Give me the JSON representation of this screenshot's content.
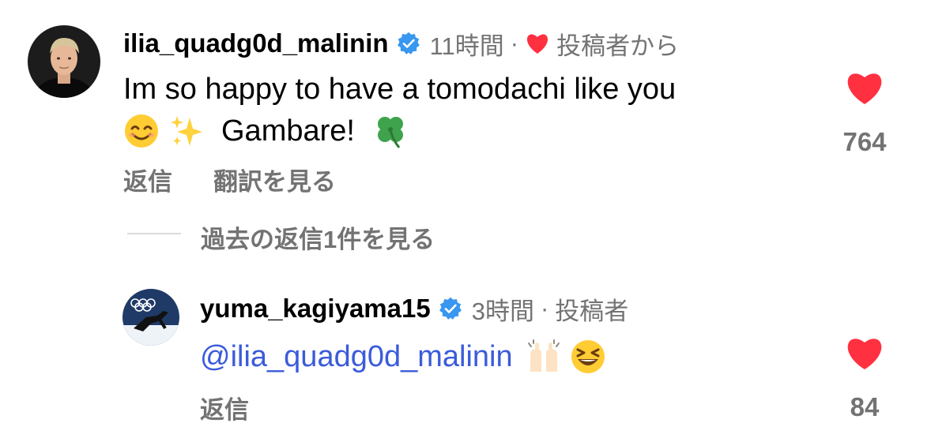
{
  "comment": {
    "username": "ilia_quadg0d_malinin",
    "time": "11時間",
    "dot": "·",
    "liked_by": "投稿者から",
    "text_line1": "Im so happy to have a tomodachi like you",
    "text_line2": "Gambare!",
    "emojis": [
      "smiling-face-emoji",
      "sparkles-emoji",
      "four-leaf-clover-emoji"
    ],
    "like_count": "764",
    "reply_label": "返信",
    "translate_label": "翻訳を見る",
    "view_replies_label": "過去の返信1件を見る"
  },
  "reply": {
    "username": "yuma_kagiyama15",
    "time": "3時間",
    "dot": "·",
    "author_label": "投稿者",
    "mention": "@ilia_quadg0d_malinin",
    "emojis": [
      "raising-hands-emoji",
      "grinning-squinting-face-emoji"
    ],
    "like_count": "84",
    "reply_label": "返信"
  },
  "colors": {
    "verified": "#3897f0",
    "heart": "#ff3040",
    "meta": "#737373",
    "mention": "#3b5bdb"
  }
}
